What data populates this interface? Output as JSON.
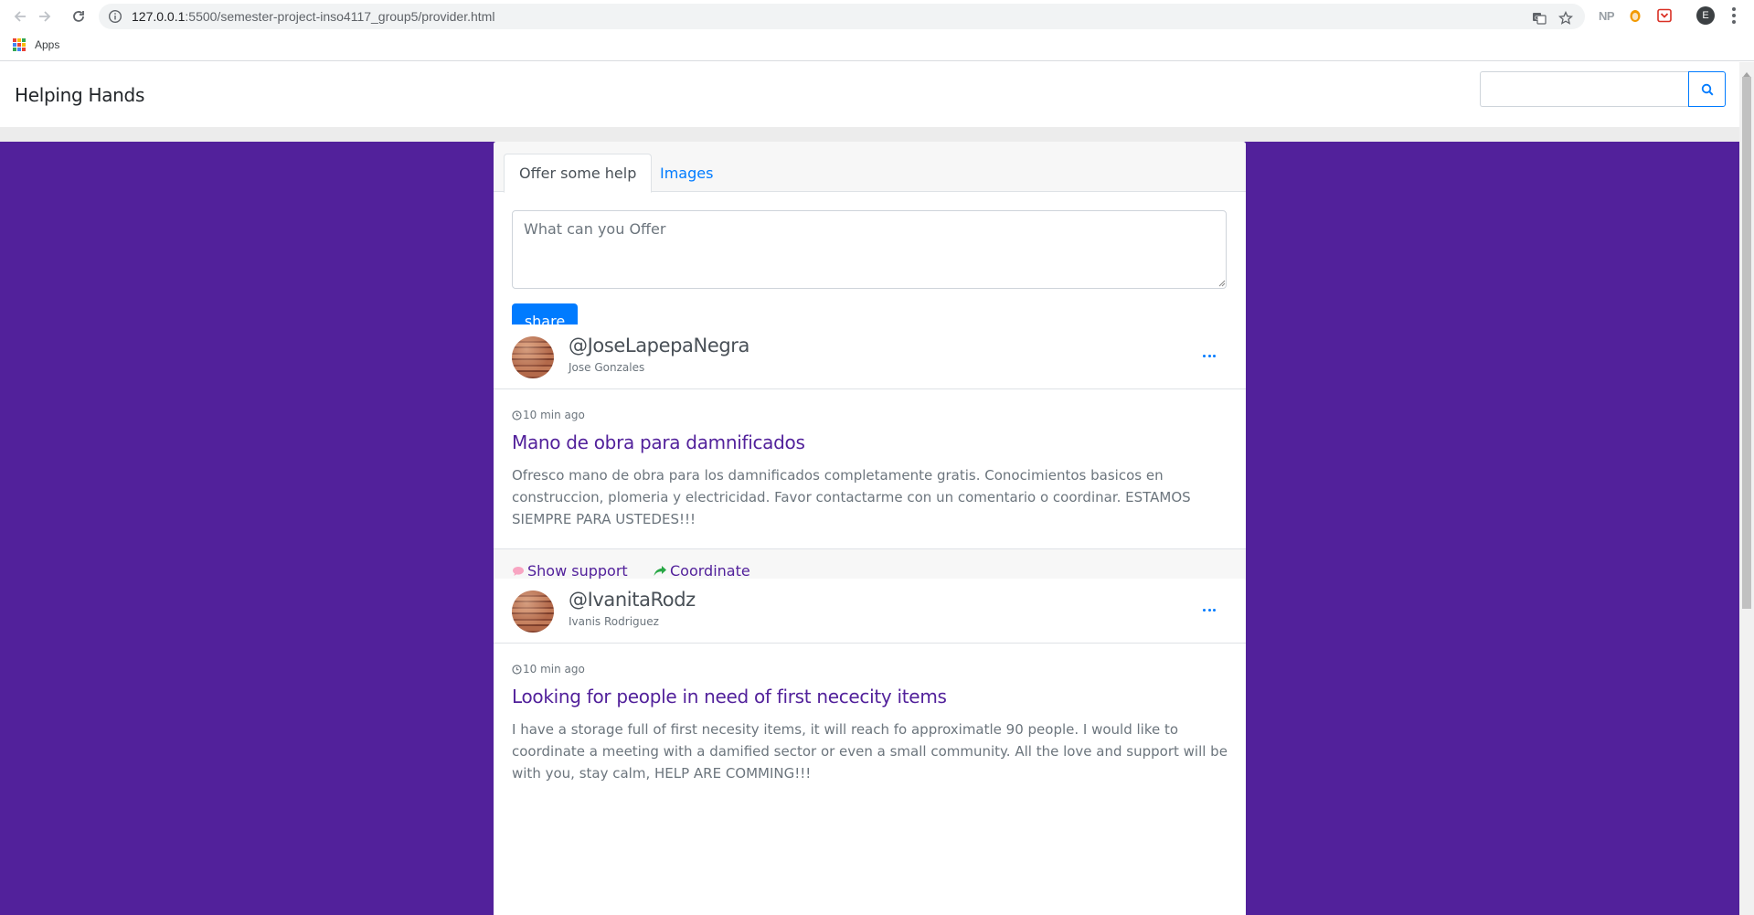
{
  "browser": {
    "url_host": "127.0.0.1",
    "url_rest": ":5500/semester-project-inso4117_group5/provider.html",
    "extension_np": "NP",
    "profile_initial": "E",
    "bookmark_apps": "Apps"
  },
  "header": {
    "brand": "Helping Hands",
    "search_placeholder": ""
  },
  "composer": {
    "tabs": [
      {
        "label": "Offer some help",
        "active": true
      },
      {
        "label": "Images",
        "active": false
      }
    ],
    "placeholder": "What can you Offer",
    "share_label": "share"
  },
  "posts": [
    {
      "handle": "@JoseLapepaNegra",
      "name": "Jose Gonzales",
      "time": "10 min ago",
      "title": "Mano de obra para damnificados",
      "body": "Ofresco mano de obra para los damnificados completamente gratis. Conocimientos basicos en construccion, plomeria y electricidad. Favor contactarme con un comentario o coordinar. ESTAMOS SIEMPRE PARA USTEDES!!!",
      "support_label": "Show support",
      "coordinate_label": "Coordinate"
    },
    {
      "handle": "@IvanitaRodz",
      "name": "Ivanis Rodriguez",
      "time": "10 min ago",
      "title": "Looking for people in need of first nececity items",
      "body": "I have a storage full of first necesity items, it will reach fo approximatle 90 people. I would like to coordinate a meeting with a damified sector or even a small community. All the love and support will be with you, stay calm, HELP ARE COMMING!!!"
    }
  ],
  "colors": {
    "page_purple": "#52219b",
    "primary_blue": "#007bff",
    "support_pink": "#f8a5c2",
    "coordinate_green": "#28a745"
  },
  "icons": {
    "search": "search-icon",
    "clock": "clock-icon",
    "support": "speech-bubble-icon",
    "coordinate": "share-arrow-icon",
    "options": "more-dots-icon"
  }
}
